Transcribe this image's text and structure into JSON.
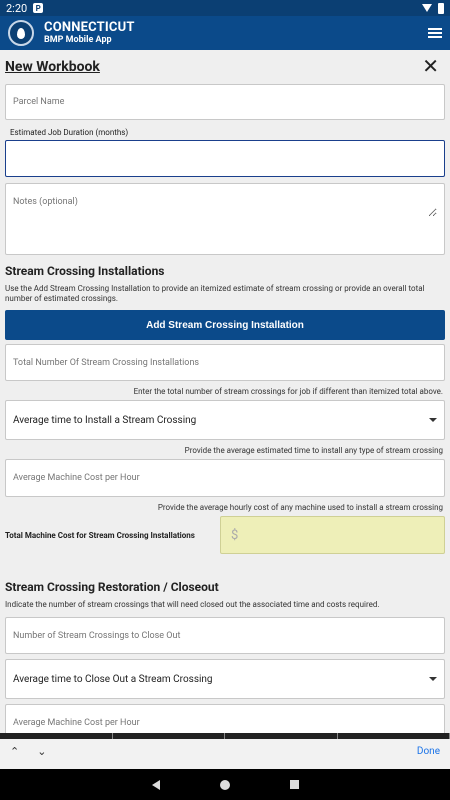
{
  "status": {
    "time": "2:20",
    "notif_icon": "P"
  },
  "app": {
    "title": "CONNECTICUT",
    "subtitle": "BMP Mobile App"
  },
  "page": {
    "title": "New Workbook",
    "close": "✕"
  },
  "fields": {
    "parcel_placeholder": "Parcel Name",
    "duration_label": "Estimated Job Duration (months)",
    "duration_value": "",
    "notes_placeholder": "Notes (optional)"
  },
  "installations": {
    "title": "Stream Crossing Installations",
    "desc": "Use the Add Stream Crossing Installation to provide an itemized estimate of stream crossing or provide an overall total number of estimated crossings.",
    "add_button": "Add Stream Crossing Installation",
    "total_placeholder": "Total Number Of Stream Crossing Installations",
    "total_hint": "Enter the total number of stream crossings for job if different than itemized total above.",
    "avg_time_select": "Average time to Install a Stream Crossing",
    "avg_time_hint": "Provide the average estimated time to install any type of stream crossing",
    "machine_cost_placeholder": "Average Machine Cost per Hour",
    "machine_cost_hint": "Provide the average hourly cost of any machine used to install a stream crossing",
    "total_cost_label": "Total Machine Cost for Stream Crossing Installations",
    "total_cost_value": "$"
  },
  "restoration": {
    "title": "Stream Crossing Restoration / Closeout",
    "desc": "Indicate the number of stream crossings that will need closed out the associated time and costs required.",
    "count_placeholder": "Number of Stream Crossings to Close Out",
    "avg_time_select": "Average time to Close Out a Stream Crossing",
    "machine_cost_placeholder": "Average Machine Cost per Hour"
  },
  "keyboard": {
    "up": "⌃",
    "down": "⌄",
    "done": "Done"
  },
  "colors": {
    "primary": "#0b4a8a",
    "highlight": "#eeefb8"
  }
}
